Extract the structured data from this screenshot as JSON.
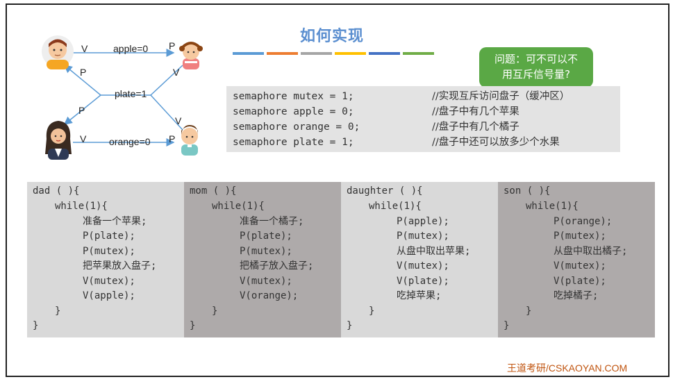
{
  "title": "如何实现",
  "color_bars": [
    "#5b9bd5",
    "#ed7d31",
    "#a5a5a5",
    "#ffc000",
    "#4472c4",
    "#70ad47"
  ],
  "bubble": {
    "line1": "问题：可不可以不",
    "line2": "用互斥信号量?"
  },
  "diagram": {
    "apple_label": "apple=0",
    "orange_label": "orange=0",
    "plate_label": "plate=1",
    "v": "V",
    "p": "P"
  },
  "semaphores": [
    {
      "code": "semaphore mutex = 1;",
      "comment": "//实现互斥访问盘子（缓冲区）"
    },
    {
      "code": "semaphore apple = 0;",
      "comment": "//盘子中有几个苹果"
    },
    {
      "code": "semaphore orange = 0;",
      "comment": "//盘子中有几个橘子"
    },
    {
      "code": "semaphore plate = 1;",
      "comment": "//盘子中还可以放多少个水果"
    }
  ],
  "processes": [
    {
      "name": "dad ( ){",
      "loop": "while(1){",
      "body": [
        "准备一个苹果;",
        "P(plate);",
        "P(mutex);",
        "把苹果放入盘子;",
        "V(mutex);",
        "V(apple);"
      ],
      "close_inner": "}",
      "close_outer": "}"
    },
    {
      "name": "mom ( ){",
      "loop": "while(1){",
      "body": [
        "准备一个橘子;",
        "P(plate);",
        "P(mutex);",
        "把橘子放入盘子;",
        "V(mutex);",
        "V(orange);"
      ],
      "close_inner": "}",
      "close_outer": "}"
    },
    {
      "name": "daughter ( ){",
      "loop": "while(1){",
      "body": [
        "P(apple);",
        "P(mutex);",
        "从盘中取出苹果;",
        "V(mutex);",
        "V(plate);",
        "吃掉苹果;"
      ],
      "close_inner": "}",
      "close_outer": "}"
    },
    {
      "name": "son ( ){",
      "loop": "while(1){",
      "body": [
        "P(orange);",
        "P(mutex);",
        "从盘中取出橘子;",
        "V(mutex);",
        "V(plate);",
        "吃掉橘子;"
      ],
      "close_inner": "}",
      "close_outer": "}"
    }
  ],
  "footer": "王道考研/CSKAOYAN.COM"
}
